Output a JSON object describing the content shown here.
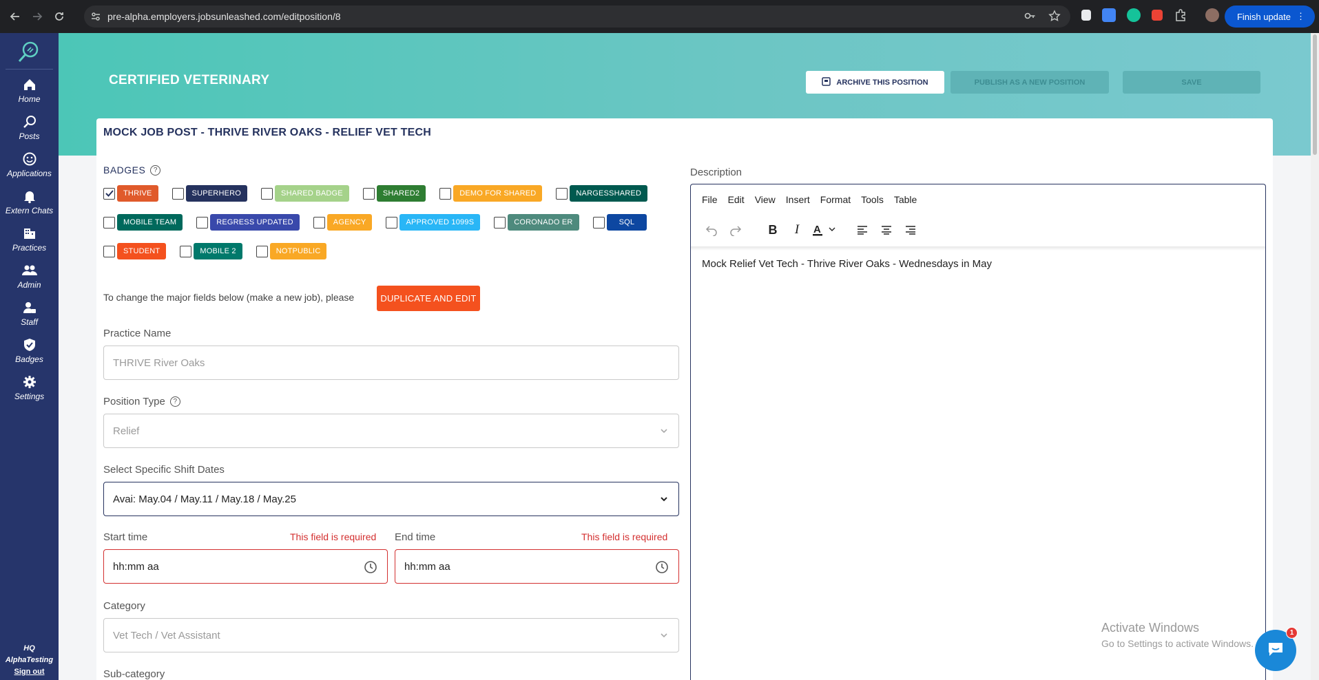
{
  "browser": {
    "url": "pre-alpha.employers.jobsunleashed.com/editposition/8",
    "finish_update": "Finish update"
  },
  "sidebar": {
    "items": [
      {
        "label": "Home",
        "icon": "home-icon"
      },
      {
        "label": "Posts",
        "icon": "posts-icon"
      },
      {
        "label": "Applications",
        "icon": "smiley-icon"
      },
      {
        "label": "Extern Chats",
        "icon": "bell-icon"
      },
      {
        "label": "Practices",
        "icon": "building-icon"
      },
      {
        "label": "Admin",
        "icon": "people-icon"
      },
      {
        "label": "Staff",
        "icon": "staff-icon"
      },
      {
        "label": "Badges",
        "icon": "shield-check-icon"
      },
      {
        "label": "Settings",
        "icon": "gear-icon"
      }
    ],
    "org_line1": "HQ",
    "org_line2": "AlphaTesting",
    "sign_out": "Sign out"
  },
  "header": {
    "title": "CERTIFIED VETERINARY",
    "archive_label": "ARCHIVE THIS POSITION",
    "publish_label": "PUBLISH AS A NEW POSITION",
    "save_label": "SAVE"
  },
  "job": {
    "title": "MOCK JOB POST - THRIVE RIVER OAKS - RELIEF VET TECH"
  },
  "badges": {
    "label": "BADGES",
    "rows": [
      [
        {
          "name": "THRIVE",
          "color": "#e05a2b",
          "checked": true
        },
        {
          "name": "SUPERHERO",
          "color": "#25325e",
          "checked": false
        },
        {
          "name": "SHARED BADGE",
          "color": "#a5d28a",
          "checked": false
        },
        {
          "name": "SHARED2",
          "color": "#2e7d32",
          "checked": false
        },
        {
          "name": "DEMO FOR SHARED",
          "color": "#f9a825",
          "checked": false
        },
        {
          "name": "NARGESSHARED",
          "color": "#00594f",
          "checked": false
        }
      ],
      [
        {
          "name": "MOBILE TEAM",
          "color": "#00695c",
          "checked": false
        },
        {
          "name": "REGRESS UPDATED",
          "color": "#3949ab",
          "checked": false
        },
        {
          "name": "AGENCY",
          "color": "#f9a825",
          "checked": false
        },
        {
          "name": "APPROVED 1099S",
          "color": "#29b6f6",
          "checked": false
        },
        {
          "name": "CORONADO ER",
          "color": "#4e8a7d",
          "checked": false
        },
        {
          "name": "SQL",
          "color": "#0d47a1",
          "checked": false
        }
      ],
      [
        {
          "name": "STUDENT",
          "color": "#f4511e",
          "checked": false
        },
        {
          "name": "MOBILE 2",
          "color": "#00796b",
          "checked": false
        },
        {
          "name": "NOTPUBLIC",
          "color": "#f9a825",
          "checked": false
        }
      ]
    ]
  },
  "duplicate": {
    "text": "To change the major fields below (make a new job), please",
    "button": "DUPLICATE AND EDIT"
  },
  "form": {
    "practice_label": "Practice Name",
    "practice_value": "THRIVE River Oaks",
    "position_type_label": "Position Type",
    "position_type_value": "Relief",
    "shift_label": "Select Specific Shift Dates",
    "shift_value": "Avai: May.04 / May.11 / May.18 / May.25",
    "start_label": "Start time",
    "start_error": "This field is required",
    "start_placeholder": "hh:mm aa",
    "end_label": "End time",
    "end_error": "This field is required",
    "end_placeholder": "hh:mm aa",
    "category_label": "Category",
    "category_value": "Vet Tech / Vet Assistant",
    "subcategory_label": "Sub-category"
  },
  "description": {
    "label": "Description",
    "menu": [
      "File",
      "Edit",
      "View",
      "Insert",
      "Format",
      "Tools",
      "Table"
    ],
    "content": "Mock Relief Vet Tech - Thrive River Oaks - Wednesdays in May"
  },
  "watermark": {
    "line1": "Activate Windows",
    "line2": "Go to Settings to activate Windows."
  },
  "chat": {
    "unread": "1"
  }
}
